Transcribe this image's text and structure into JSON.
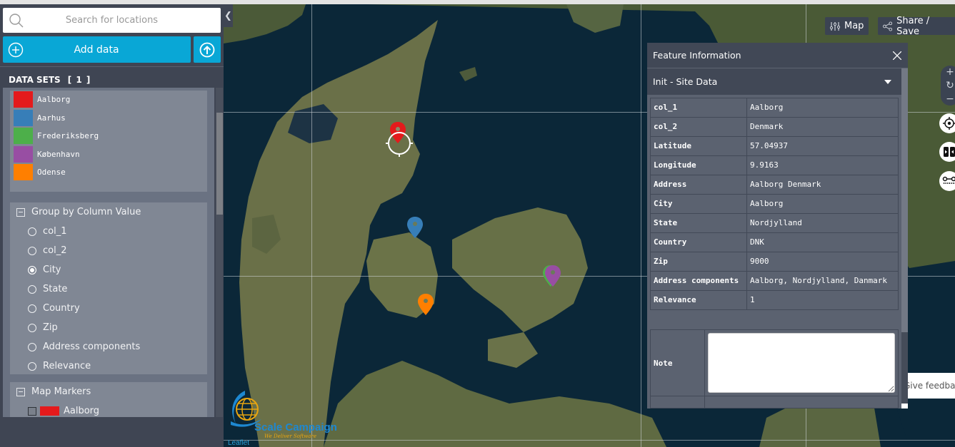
{
  "sidebar": {
    "search_placeholder": "Search for locations",
    "add_data_label": "Add data",
    "datasets_title": "DATA SETS",
    "datasets_count": "[ 1 ]",
    "legend": [
      {
        "label": "Aalborg",
        "color": "#e41a1c"
      },
      {
        "label": "Aarhus",
        "color": "#377eb8"
      },
      {
        "label": "Frederiksberg",
        "color": "#4daf4a"
      },
      {
        "label": "København",
        "color": "#984ea3"
      },
      {
        "label": "Odense",
        "color": "#ff7f00"
      }
    ],
    "group_by": {
      "title": "Group by Column Value",
      "options": [
        "col_1",
        "col_2",
        "City",
        "State",
        "Country",
        "Zip",
        "Address components",
        "Relevance"
      ],
      "selected": "City"
    },
    "map_markers": {
      "title": "Map Markers",
      "items": [
        {
          "label": "Aalborg",
          "color": "#e41a1c",
          "checked": false
        }
      ]
    }
  },
  "map": {
    "buttons": {
      "map_label": "Map",
      "share_label": "Share / Save"
    },
    "zoom": {
      "in": "+",
      "reset": "↻",
      "out": "−"
    },
    "feedback_label": "Give feedback",
    "attribution": "Leaflet",
    "logo": {
      "name": "Scale Campaign",
      "tagline": "We Deliver Software"
    },
    "markers": [
      {
        "city": "Aalborg",
        "color": "#e41a1c"
      },
      {
        "city": "Aarhus",
        "color": "#377eb8"
      },
      {
        "city": "Frederiksberg",
        "color": "#4daf4a"
      },
      {
        "city": "København",
        "color": "#984ea3"
      },
      {
        "city": "Odense",
        "color": "#ff7f00"
      }
    ]
  },
  "feature_info": {
    "title": "Feature Information",
    "layer_select": "Init - Site Data",
    "rows": [
      {
        "key": "col_1",
        "value": "Aalborg"
      },
      {
        "key": "col_2",
        "value": "Denmark"
      },
      {
        "key": "Latitude",
        "value": "57.04937"
      },
      {
        "key": "Longitude",
        "value": "9.9163"
      },
      {
        "key": "Address",
        "value": "Aalborg Denmark"
      },
      {
        "key": "City",
        "value": "Aalborg"
      },
      {
        "key": "State",
        "value": "Nordjylland"
      },
      {
        "key": "Country",
        "value": "DNK"
      },
      {
        "key": "Zip",
        "value": "9000"
      },
      {
        "key": "Address components",
        "value": "Aalborg, Nordjylland, Danmark"
      },
      {
        "key": "Relevance",
        "value": "1"
      }
    ],
    "note_label": "Note",
    "note_value": ""
  }
}
